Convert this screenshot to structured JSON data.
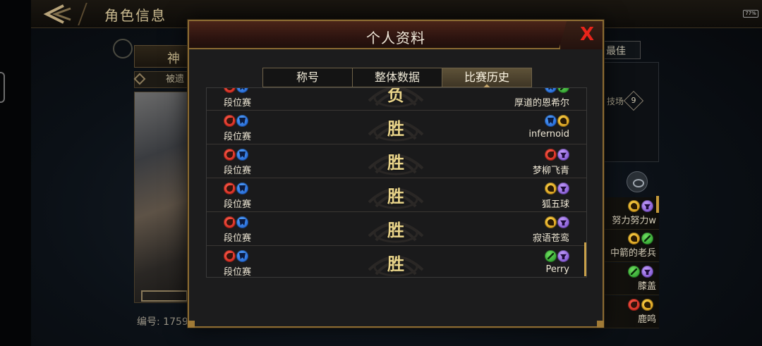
{
  "app": {
    "page_title": "角色信息",
    "battery": "77%"
  },
  "background": {
    "tab_god": "神",
    "passive_label": "被遗",
    "serial_label": "编号: 1759",
    "right_box_label": "最佳",
    "arena_label": "技场",
    "arena_rank": "9",
    "friends": [
      {
        "name": "努力努力w",
        "icons": [
          "gold",
          "purple"
        ]
      },
      {
        "name": "中箭的老兵",
        "icons": [
          "gold",
          "green"
        ]
      },
      {
        "name": "膝盖",
        "icons": [
          "green",
          "purple"
        ]
      },
      {
        "name": "鹿鸣",
        "icons": [
          "red",
          "gold"
        ]
      }
    ]
  },
  "modal": {
    "title": "个人资料",
    "close_label": "X",
    "tabs": [
      {
        "label": "称号",
        "active": false
      },
      {
        "label": "整体数据",
        "active": false
      },
      {
        "label": "比赛历史",
        "active": true
      }
    ],
    "matches": [
      {
        "mode": "段位赛",
        "mode_icons": [
          "red",
          "blue"
        ],
        "result": "负",
        "opponent": "厚道的恩希尔",
        "opp_icons": [
          "blue",
          "green"
        ]
      },
      {
        "mode": "段位赛",
        "mode_icons": [
          "red",
          "blue"
        ],
        "result": "胜",
        "opponent": "infernoid",
        "opp_icons": [
          "blue",
          "gold"
        ]
      },
      {
        "mode": "段位赛",
        "mode_icons": [
          "red",
          "blue"
        ],
        "result": "胜",
        "opponent": "梦柳飞青",
        "opp_icons": [
          "red",
          "purple"
        ]
      },
      {
        "mode": "段位赛",
        "mode_icons": [
          "red",
          "blue"
        ],
        "result": "胜",
        "opponent": "狐五球",
        "opp_icons": [
          "gold",
          "purple"
        ]
      },
      {
        "mode": "段位赛",
        "mode_icons": [
          "red",
          "blue"
        ],
        "result": "胜",
        "opponent": "寂语苍鸾",
        "opp_icons": [
          "gold",
          "purple"
        ]
      },
      {
        "mode": "段位赛",
        "mode_icons": [
          "red",
          "blue"
        ],
        "result": "胜",
        "opponent": "Perry",
        "opp_icons": [
          "green",
          "purple"
        ]
      }
    ]
  },
  "colors": {
    "accent_gold": "#8a6a32",
    "result_text": "#e9d48a",
    "close_red": "#e8241a"
  }
}
